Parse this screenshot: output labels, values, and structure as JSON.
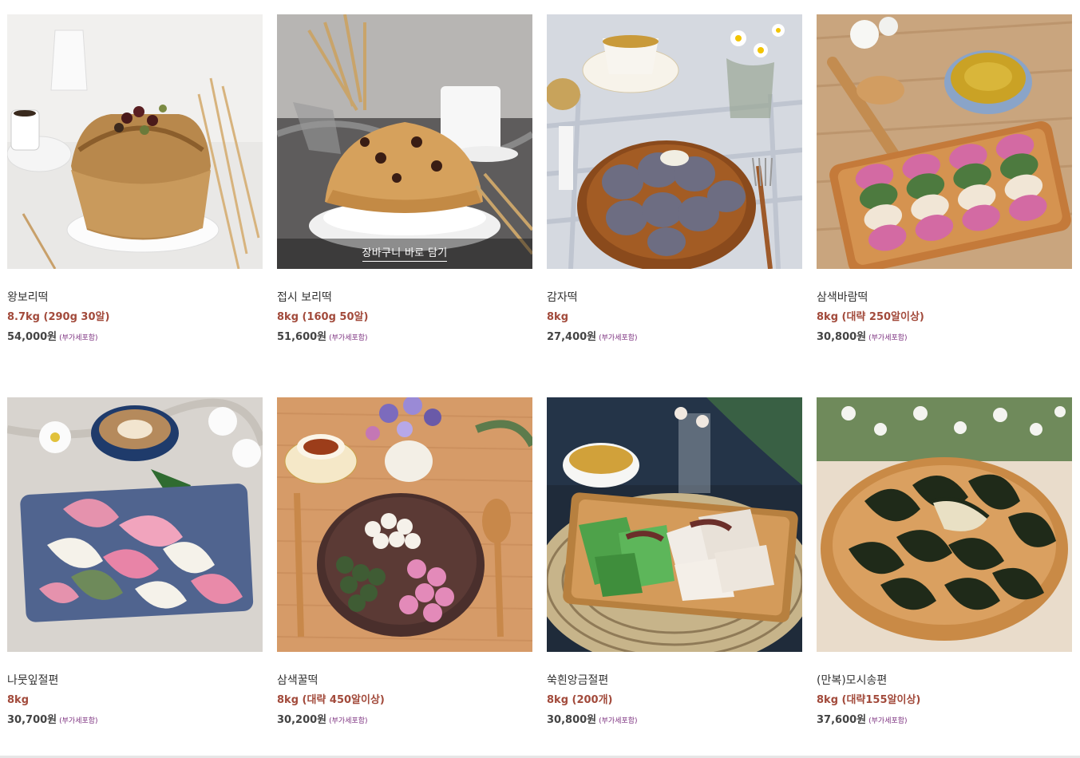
{
  "products": [
    {
      "name": "왕보리떡",
      "option": "8.7kg (290g 30알)",
      "price": "54,000원",
      "vat": "(부가세포함)",
      "cta": ""
    },
    {
      "name": "접시 보리떡",
      "option": "8kg (160g 50알)",
      "price": "51,600원",
      "vat": "(부가세포함)",
      "cta": "장바구니 바로 담기"
    },
    {
      "name": "감자떡",
      "option": "8kg",
      "price": "27,400원",
      "vat": "(부가세포함)",
      "cta": ""
    },
    {
      "name": "삼색바람떡",
      "option": "8kg (대략 250알이상)",
      "price": "30,800원",
      "vat": "(부가세포함)",
      "cta": ""
    },
    {
      "name": "나뭇잎절편",
      "option": "8kg",
      "price": "30,700원",
      "vat": "(부가세포함)",
      "cta": ""
    },
    {
      "name": "삼색꿀떡",
      "option": "8kg (대략 450알이상)",
      "price": "30,200원",
      "vat": "(부가세포함)",
      "cta": ""
    },
    {
      "name": "쑥흰앙금절편",
      "option": "8kg (200개)",
      "price": "30,800원",
      "vat": "(부가세포함)",
      "cta": ""
    },
    {
      "name": "(만복)모시송편",
      "option": "8kg (대략155알이상)",
      "price": "37,600원",
      "vat": "(부가세포함)",
      "cta": ""
    }
  ],
  "colors": {
    "option_text": "#a24a3b",
    "vat_text": "#7b2f7e",
    "name_text": "#333333",
    "price_text": "#444444"
  }
}
